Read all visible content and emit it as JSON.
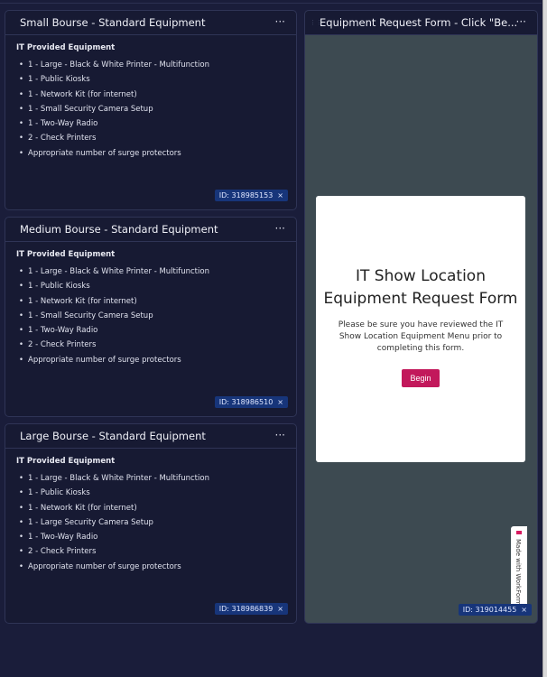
{
  "panels": [
    {
      "title": "Small Bourse - Standard Equipment",
      "subtitle": "IT Provided Equipment",
      "items": [
        "1 - Large - Black & White Printer - Multifunction",
        "1 - Public Kiosks",
        "1 - Network Kit (for internet)",
        "1 - Small Security Camera Setup",
        "1 - Two-Way Radio",
        "2 - Check Printers",
        "Appropriate number of surge protectors"
      ],
      "id": "ID: 318985153"
    },
    {
      "title": "Medium Bourse - Standard Equipment",
      "subtitle": "IT Provided Equipment",
      "items": [
        "1 - Large - Black & White Printer - Multifunction",
        "1 - Public Kiosks",
        "1 - Network Kit (for internet)",
        "1 - Small Security Camera Setup",
        "1 - Two-Way Radio",
        "2 - Check Printers",
        "Appropriate number of surge protectors"
      ],
      "id": "ID: 318986510"
    },
    {
      "title": "Large Bourse - Standard Equipment",
      "subtitle": "IT Provided Equipment",
      "items": [
        "1 - Large - Black & White Printer - Multifunction",
        "1 - Public Kiosks",
        "1 - Network Kit (for internet)",
        "1 - Large Security Camera Setup",
        "1 - Two-Way Radio",
        "2 - Check Printers",
        "Appropriate number of surge protectors"
      ],
      "id": "ID: 318986839"
    }
  ],
  "form_panel": {
    "title": "Equipment Request Form - Click \"Be...",
    "form_title": "IT Show Location Equipment Request Form",
    "description": "Please be sure you have reviewed the IT Show Location Equipment Menu prior to completing this form.",
    "begin_label": "Begin",
    "badge": "Made with WorkForms",
    "id": "ID: 319014455"
  },
  "menu_icon": "···",
  "close_icon": "×"
}
